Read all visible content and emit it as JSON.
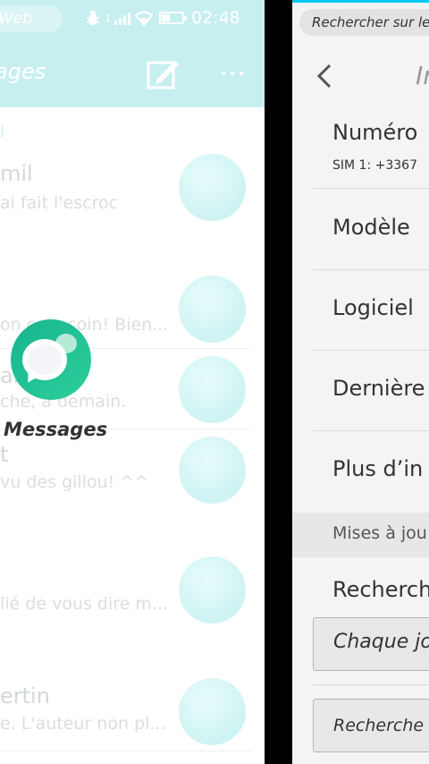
{
  "left_card": {
    "status_bar": {
      "url_partial": "Web",
      "signal_label": "1",
      "time": "02:48"
    },
    "app_bar": {
      "title_partial": "ages"
    },
    "section_partial": "l",
    "threads": [
      {
        "name": "mil",
        "preview": "ai fait l'escroc"
      },
      {
        "name": "",
        "preview": "on coin coin! Bien..."
      },
      {
        "name": "ai",
        "preview": "che, à demain."
      },
      {
        "name": "t",
        "preview": "vu des gillou! ^^"
      },
      {
        "name": "",
        "preview": "lié de vous dire m..."
      },
      {
        "name": "ertin",
        "preview": "e. L'auteur non pl..."
      }
    ],
    "app_icon_label": "Messages"
  },
  "right_card": {
    "search_placeholder": "Rechercher sur le Web",
    "page_title_partial": "In",
    "items": [
      {
        "label": "Numéro",
        "sub": "SIM 1: +3367"
      },
      {
        "label": "Modèle"
      },
      {
        "label": "Logiciel"
      },
      {
        "label": "Dernière"
      },
      {
        "label": "Plus d’in"
      }
    ],
    "section_header": "Mises à jou",
    "updates_label": "Recherch",
    "frequency_select": "Chaque jo",
    "check_button": "Recherche"
  },
  "colors": {
    "messages_header": "#c8eff0",
    "accent_bar": "#00caf2",
    "app_icon": "#16b48e"
  }
}
